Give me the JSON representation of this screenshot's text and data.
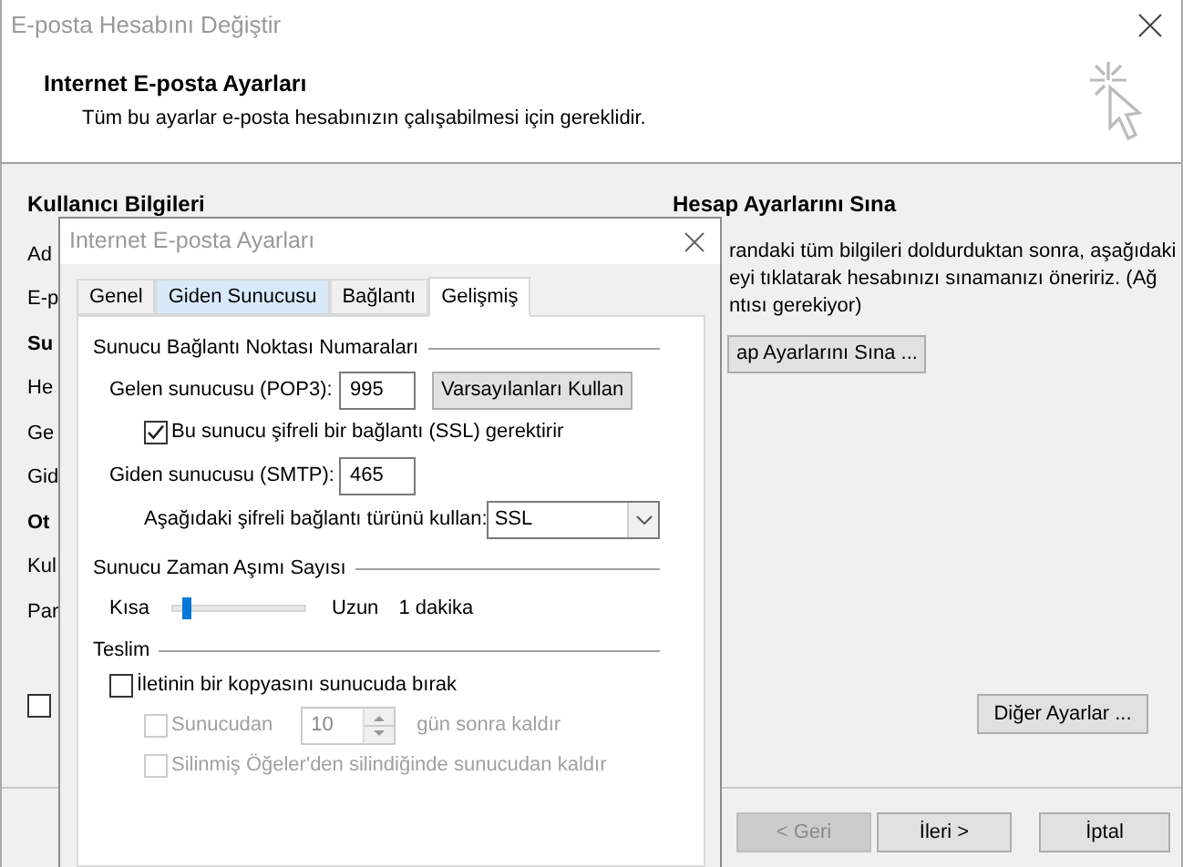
{
  "window": {
    "title": "E-posta Hesabını Değiştir"
  },
  "header": {
    "title": "Internet E-posta Ayarları",
    "subtitle": "Tüm bu ayarlar e-posta hesabınızın çalışabilmesi için gereklidir."
  },
  "left_section": {
    "heading": "Kullanıcı Bilgileri",
    "items": [
      {
        "text": "Ad",
        "kind": "label"
      },
      {
        "text": "E-p",
        "kind": "label"
      },
      {
        "text": "Su",
        "kind": "heading"
      },
      {
        "text": "He",
        "kind": "label"
      },
      {
        "text": "Ge",
        "kind": "label"
      },
      {
        "text": "Gid",
        "kind": "label"
      },
      {
        "text": "Ot",
        "kind": "heading"
      },
      {
        "text": "Kul",
        "kind": "label"
      },
      {
        "text": "Par",
        "kind": "label"
      }
    ],
    "checkbox": {
      "checked": false
    }
  },
  "right_section": {
    "heading": "Hesap Ayarlarını Sına",
    "lines": [
      "randaki tüm bilgileri doldurduktan sonra, aşağıdaki",
      "eyi tıklatarak hesabınızı sınamanızı öneririz. (Ağ",
      "ntısı gerekiyor)"
    ],
    "button": "ap Ayarlarını Sına ...",
    "more_button": "Diğer Ayarlar ..."
  },
  "footer_buttons": [
    {
      "label": "< Geri",
      "disabled": true
    },
    {
      "label": "İleri >",
      "disabled": false
    },
    {
      "label": "İptal",
      "disabled": false
    }
  ],
  "dialog": {
    "title": "Internet E-posta Ayarları",
    "tabs": [
      {
        "label": "Genel",
        "selected": false,
        "hovered": false
      },
      {
        "label": "Giden Sunucusu",
        "selected": false,
        "hovered": true
      },
      {
        "label": "Bağlantı",
        "selected": false,
        "hovered": false
      },
      {
        "label": "Gelişmiş",
        "selected": true,
        "hovered": false
      }
    ],
    "ports": {
      "heading": "Sunucu Bağlantı Noktası Numaraları",
      "incoming_label": "Gelen sunucusu (POP3):",
      "incoming_value": "995",
      "defaults_button": "Varsayılanları Kullan",
      "ssl_checkbox": {
        "label": "Bu sunucu şifreli bir bağlantı (SSL) gerektirir",
        "checked": true
      },
      "outgoing_label": "Giden sunucusu (SMTP):",
      "outgoing_value": "465",
      "encryption_label": "Aşağıdaki şifreli bağlantı türünü kullan:",
      "encryption_value": "SSL"
    },
    "timeout": {
      "heading": "Sunucu Zaman Aşımı Sayısı",
      "short_label": "Kısa",
      "long_label": "Uzun",
      "level": 0.1,
      "reading": "1 dakika"
    },
    "delivery": {
      "heading": "Teslim",
      "leave_copy": {
        "label": "İletinin bir kopyasını sunucuda bırak",
        "checked": false,
        "disabled": false
      },
      "remove_after": {
        "label": "Sunucudan",
        "checked": false,
        "disabled": true,
        "value": "10",
        "suffix": "gün sonra kaldır"
      },
      "remove_deleted": {
        "label": "Silinmiş Öğeler'den silindiğinde sunucudan kaldır",
        "checked": false,
        "disabled": true
      }
    }
  }
}
